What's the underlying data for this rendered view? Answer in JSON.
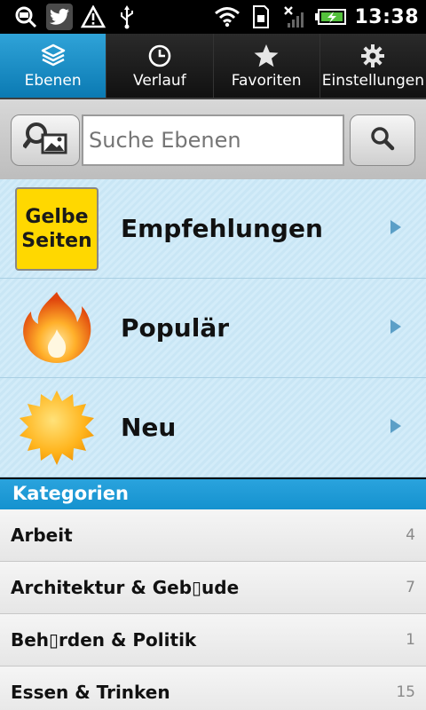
{
  "status_bar": {
    "time": "13:38",
    "icons": [
      "maps-notification-icon",
      "twitter-icon",
      "warning-icon",
      "usb-icon",
      "wifi-icon",
      "sim-icon",
      "no-signal-icon",
      "battery-charging-icon"
    ]
  },
  "tabs": [
    {
      "label": "Ebenen",
      "icon": "layers-icon",
      "active": true
    },
    {
      "label": "Verlauf",
      "icon": "clock-icon",
      "active": false
    },
    {
      "label": "Favoriten",
      "icon": "star-icon",
      "active": false
    },
    {
      "label": "Einstellungen",
      "icon": "gear-icon",
      "active": false
    }
  ],
  "search": {
    "placeholder": "Suche Ebenen",
    "value": ""
  },
  "featured": [
    {
      "label": "Empfehlungen",
      "icon": "gelbe-seiten-logo",
      "logo_line1": "Gelbe",
      "logo_line2": "Seiten"
    },
    {
      "label": "Populär",
      "icon": "flame-icon"
    },
    {
      "label": "Neu",
      "icon": "sun-badge-icon"
    }
  ],
  "categories_header": "Kategorien",
  "categories": [
    {
      "label": "Arbeit",
      "count": "4"
    },
    {
      "label": "Architektur & Geb▯ude",
      "count": "7"
    },
    {
      "label": "Beh▯rden & Politik",
      "count": "1"
    },
    {
      "label": "Essen & Trinken",
      "count": "15"
    }
  ],
  "colors": {
    "accent": "#1592cf",
    "tab_active": "#2fa3d8",
    "featured_bg": "#cde8f6",
    "logo_yellow": "#ffd800"
  }
}
